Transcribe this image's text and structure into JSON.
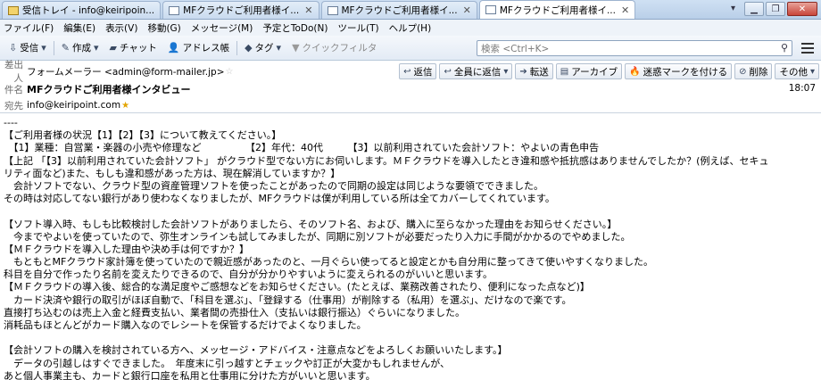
{
  "tabs": [
    {
      "label": "受信トレイ - info@keiripoin...",
      "icon": "inbox-icon"
    },
    {
      "label": "MFクラウドご利用者様イ...",
      "icon": "mail-icon"
    },
    {
      "label": "MFクラウドご利用者様イ...",
      "icon": "mail-icon"
    },
    {
      "label": "MFクラウドご利用者様イ...",
      "icon": "mail-icon"
    }
  ],
  "menu": [
    "ファイル(F)",
    "編集(E)",
    "表示(V)",
    "移動(G)",
    "メッセージ(M)",
    "予定とToDo(N)",
    "ツール(T)",
    "ヘルプ(H)"
  ],
  "toolbar": {
    "receive": "受信",
    "compose": "作成",
    "chat": "チャット",
    "addressbook": "アドレス帳",
    "tag": "タグ",
    "quickfilter": "クイックフィルタ",
    "search_placeholder": "検索 <Ctrl+K>"
  },
  "header": {
    "from_label": "差出人",
    "from_value": "フォームメーラー <admin@form-mailer.jp>",
    "subject_label": "件名",
    "subject_value": "MFクラウドご利用者様インタビュー",
    "to_label": "宛先",
    "to_value": "info@keiripoint.com",
    "time": "18:07",
    "actions": {
      "reply": "返信",
      "reply_all": "全員に返信",
      "forward": "転送",
      "archive": "アーカイブ",
      "junk": "迷惑マークを付ける",
      "delete": "削除",
      "other": "その他"
    }
  },
  "body_lines": [
    "----",
    "【ご利用者様の状況【1】【2】【3】について教えてください。】",
    "　【1】業種：自営業・楽器の小売や修理など　　　　　【2】年代：40代　　　【3】以前利用されていた会計ソフト：やよいの青色申告",
    "【上記 「【3】以前利用されていた会計ソフト」 がクラウド型でない方にお伺いします。ＭＦクラウドを導入したとき違和感や抵抗感はありませんでしたか？(例えば、セキュ",
    "リティ面など)また、もしも違和感があった方は、現在解消していますか？】",
    "　会計ソフトでない、クラウド型の資産管理ソフトを使ったことがあったので同期の設定は同じような要領でできました。",
    "その時は対応してない銀行があり使わなくなりましたが、MFクラウドは僕が利用している所は全てカバーしてくれています。",
    "",
    "【ソフト導入時、もしも比較検討した会計ソフトがありましたら、そのソフト名、および、購入に至らなかった理由をお知らせください。】",
    "　今までやよいを使っていたので、弥生オンラインも試してみましたが、同期に別ソフトが必要だったり入力に手間がかかるのでやめました。",
    "【ＭＦクラウドを導入した理由や決め手は何ですか？】",
    "　もともとMFクラウド家計簿を使っていたので親近感があったのと、一月ぐらい使ってると設定とかも自分用に整ってきて使いやすくなりました。",
    "科目を自分で作ったり名前を変えたりできるので、自分が分かりやすいように変えられるのがいいと思います。",
    "【ＭＦクラウドの導入後、総合的な満足度やご感想などをお知らせください。(たとえば、業務改善されたり、便利になった点など)】",
    "　カード決済や銀行の取引がほぼ自動で、「科目を選ぶ」、「登録する（仕事用）が削除する（私用）を選ぶ」、だけなので楽です。",
    "直接打ち込むのは売上入金と経費支払い、業者間の売掛仕入（支払いは銀行振込）ぐらいになりました。",
    "消耗品もほとんどがカード購入なのでレシートを保管するだけでよくなりました。",
    "",
    "【会計ソフトの購入を検討されている方へ、メッセージ・アドバイス・注意点などをよろしくお願いいたします。】",
    "　データの引越しはすぐできました。　年度末に引っ越すとチェックや訂正が大変かもしれませんが、",
    "あと個人事業主も、カードと銀行口座を私用と仕事用に分けた方がいいと思います。"
  ]
}
